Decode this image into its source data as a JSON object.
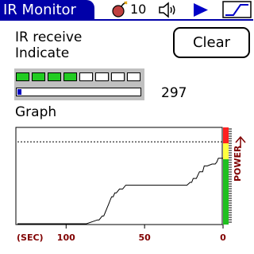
{
  "app": {
    "title": "IR Monitor",
    "bomb_count": "10",
    "icons": {
      "bomb": "bomb-icon",
      "speaker": "speaker-icon",
      "play": "play-icon",
      "waveform": "step-wave-icon"
    }
  },
  "receive": {
    "label": "IR receive Indicate",
    "clear_label": "Clear",
    "leds_total": 8,
    "leds_on": 4,
    "signal_value": "297",
    "signal_fraction": 0.03
  },
  "graph": {
    "label": "Graph"
  },
  "colors": {
    "title_bar": "#0000a8",
    "led_on": "#22cc22",
    "led_off": "#ffffff",
    "signal_fill": "#0000c0",
    "axis_labels": "#800000",
    "power_scale": [
      "#ff2020",
      "#ffff40",
      "#20c020"
    ]
  },
  "chart_data": {
    "type": "line",
    "x_unit_label": "(SEC)",
    "x_ticks": [
      "100",
      "50",
      "0"
    ],
    "x_tick_values": [
      100,
      50,
      0
    ],
    "xlim": [
      131,
      0
    ],
    "ylim": [
      0,
      100
    ],
    "side_label": "POWER",
    "threshold": 85,
    "grid": false,
    "x": [
      131,
      87,
      80,
      79,
      77,
      76,
      75,
      74,
      73,
      72,
      71,
      70,
      69,
      68,
      66,
      65,
      64,
      62,
      60,
      59,
      57,
      55,
      53,
      23,
      21,
      20,
      19,
      18,
      17,
      15,
      14,
      13,
      12,
      10,
      7,
      5,
      4,
      3,
      2,
      0
    ],
    "values": [
      0,
      0,
      4,
      4,
      8,
      8,
      12,
      16,
      20,
      24,
      28,
      28,
      32,
      32,
      36,
      36,
      36,
      40,
      40,
      40,
      40,
      40,
      40,
      40,
      43,
      43,
      47,
      47,
      47,
      54,
      54,
      54,
      60,
      60,
      62,
      62,
      64,
      68,
      68,
      68
    ]
  }
}
